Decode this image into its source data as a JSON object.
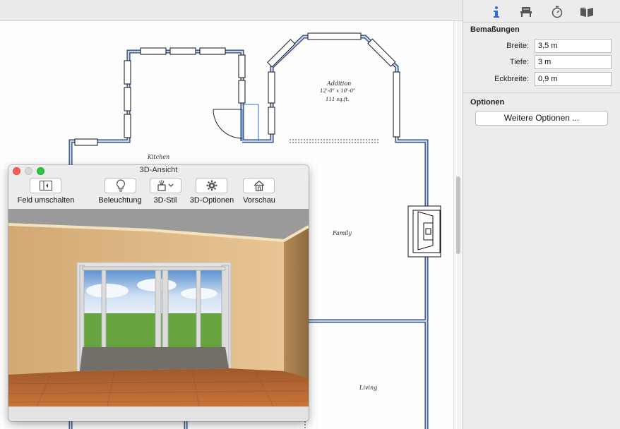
{
  "floorplan": {
    "rooms": {
      "kitchen": "Kitchen",
      "addition_name": "Addition",
      "addition_dims": "12'-0\" x 10'-0\"",
      "addition_area": "111 sq.ft.",
      "family": "Family",
      "living": "Living"
    }
  },
  "inspector": {
    "tabs": [
      {
        "icon": "info-icon",
        "symbol": "i"
      },
      {
        "icon": "furniture-icon",
        "symbol": "chair"
      },
      {
        "icon": "timer-icon",
        "symbol": "stopwatch"
      },
      {
        "icon": "library-icon",
        "symbol": "book"
      }
    ],
    "dimensions": {
      "title": "Bemaßungen",
      "width_label": "Breite:",
      "width_value": "3,5 m",
      "depth_label": "Tiefe:",
      "depth_value": "3 m",
      "corner_label": "Eckbreite:",
      "corner_value": "0,9 m"
    },
    "options": {
      "title": "Optionen",
      "more_button": "Weitere Optionen ..."
    }
  },
  "window3d": {
    "title": "3D-Ansicht",
    "toolbar": {
      "toggle_panel": "Feld umschalten",
      "lighting": "Beleuchtung",
      "style": "3D-Stil",
      "options": "3D-Optionen",
      "preview": "Vorschau"
    }
  },
  "colors": {
    "wall_fill": "#c9d6e8",
    "wall_stroke": "#1f3f72",
    "accent_blue": "#2d6de0",
    "close": "#fc5f57",
    "minimize": "#d8d8d8",
    "zoom": "#2ac840"
  }
}
